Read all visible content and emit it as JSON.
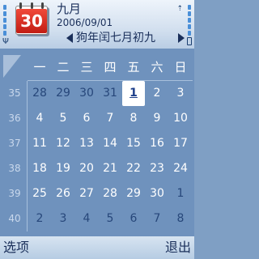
{
  "header": {
    "icon_day": "30",
    "month": "九月",
    "date": "2006/09/01",
    "lunar": "狗年闰七月初九"
  },
  "weekdays": [
    "一",
    "二",
    "三",
    "四",
    "五",
    "六",
    "日"
  ],
  "weeks": [
    {
      "num": "35",
      "days": [
        "28",
        "29",
        "30",
        "31",
        "1",
        "2",
        "3"
      ],
      "dim": [
        true,
        true,
        true,
        true,
        false,
        false,
        false
      ]
    },
    {
      "num": "36",
      "days": [
        "4",
        "5",
        "6",
        "7",
        "8",
        "9",
        "10"
      ],
      "dim": [
        false,
        false,
        false,
        false,
        false,
        false,
        false
      ]
    },
    {
      "num": "37",
      "days": [
        "11",
        "12",
        "13",
        "14",
        "15",
        "16",
        "17"
      ],
      "dim": [
        false,
        false,
        false,
        false,
        false,
        false,
        false
      ]
    },
    {
      "num": "38",
      "days": [
        "18",
        "19",
        "20",
        "21",
        "22",
        "23",
        "24"
      ],
      "dim": [
        false,
        false,
        false,
        false,
        false,
        false,
        false
      ]
    },
    {
      "num": "39",
      "days": [
        "25",
        "26",
        "27",
        "28",
        "29",
        "30",
        "1"
      ],
      "dim": [
        false,
        false,
        false,
        false,
        false,
        false,
        true
      ]
    },
    {
      "num": "40",
      "days": [
        "2",
        "3",
        "4",
        "5",
        "6",
        "7",
        "8"
      ],
      "dim": [
        true,
        true,
        true,
        true,
        true,
        true,
        true
      ]
    }
  ],
  "softkeys": {
    "left": "选项",
    "right": "退出"
  },
  "icons": {
    "signal": "signal-strength-icon",
    "antenna": "antenna-icon",
    "battery": "battery-icon",
    "calendar": "calendar-icon",
    "nav_left": "arrow-left-icon",
    "nav_right": "arrow-right-icon"
  }
}
